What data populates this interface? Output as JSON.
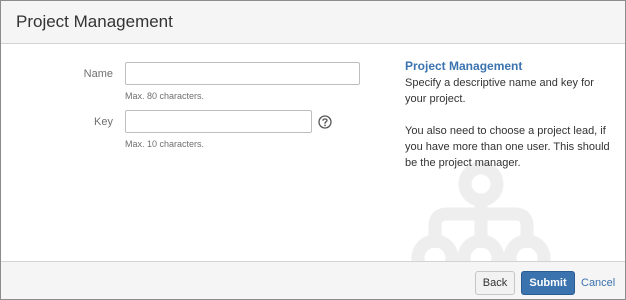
{
  "dialog": {
    "title": "Project Management"
  },
  "form": {
    "name": {
      "label": "Name",
      "value": "",
      "hint": "Max. 80 characters."
    },
    "key": {
      "label": "Key",
      "value": "",
      "hint": "Max. 10 characters.",
      "help_icon": "help-circle-icon"
    }
  },
  "info": {
    "title": "Project Management",
    "paragraph_1": "Specify a descriptive name and key for your project.",
    "paragraph_2": "You also need to choose a project lead, if you have more than one user. This should be the project manager."
  },
  "footer": {
    "back_label": "Back",
    "submit_label": "Submit",
    "cancel_label": "Cancel"
  },
  "colors": {
    "accent": "#3b73af",
    "header_bg": "#f5f5f5",
    "watermark": "#eeeeee"
  }
}
